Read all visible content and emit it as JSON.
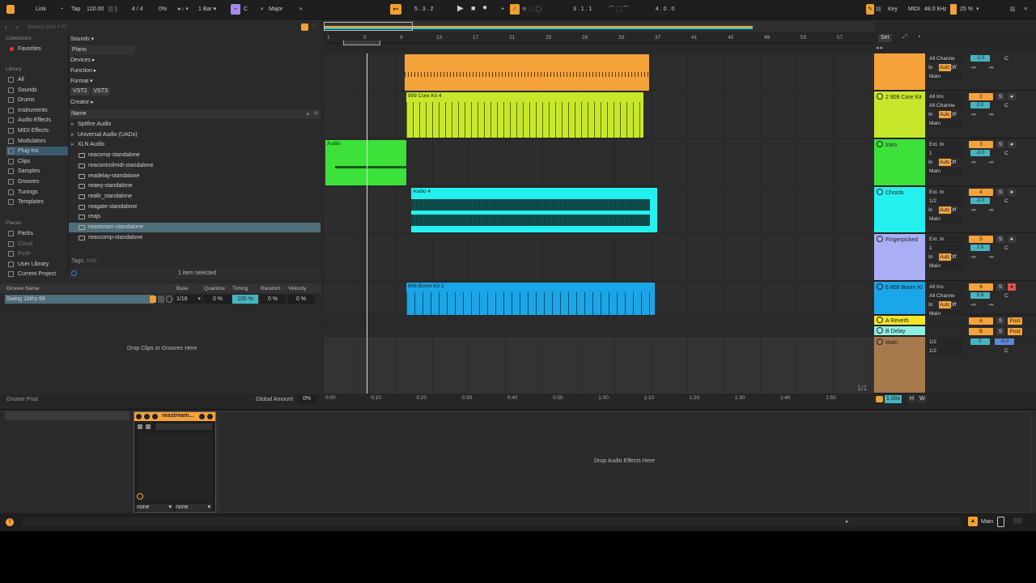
{
  "transport": {
    "link": "Link",
    "tap": "Tap",
    "tempo": "120.00",
    "meter": "4 / 4",
    "swing": "0%",
    "quantize": "1 Bar",
    "key": "C",
    "scale": "Major",
    "position": "5 .  3 .  2",
    "loop_start": "3 .  1 .  1",
    "loop_length": "4 .  0 .  0",
    "key_btn": "Key",
    "midi": "MIDI",
    "sample_rate": "48.0 kHz",
    "cpu": "25 %"
  },
  "browser": {
    "search_placeholder": "Search (Ctrl + F)",
    "collections_heading": "Collections",
    "favorites": "Favorites",
    "library_heading": "Library",
    "library": [
      "All",
      "Sounds",
      "Drums",
      "Instruments",
      "Audio Effects",
      "MIDI Effects",
      "Modulators",
      "Plug-Ins",
      "Clips",
      "Samples",
      "Grooves",
      "Tunings",
      "Templates"
    ],
    "places_heading": "Places",
    "places": [
      "Packs",
      "Cloud",
      "Push",
      "User Library",
      "Current Project"
    ],
    "filters": {
      "sounds": "Sounds ▾",
      "piano": "Piano",
      "devices": "Devices ▸",
      "function": "Function ▸",
      "format": "Format ▾",
      "vst2": "VST2",
      "vst3": "VST3",
      "creator": "Creator ▸"
    },
    "name_header": "Name",
    "folders": [
      "Spitfire Audio",
      "Universal Audio (UADx)",
      "XLN Audio"
    ],
    "files": [
      "reacomp-standalone",
      "reacontrolmidi-standalone",
      "readelay-standalone",
      "reaeq-standalone",
      "reafir_standalone",
      "reagate-standalone",
      "reajs",
      "reastream-standalone",
      "reaxcomp-standalone"
    ],
    "tags_label": "Tags:",
    "tags_placeholder": "Add...",
    "status": "1 item selected"
  },
  "groove": {
    "headers": [
      "Groove Name",
      "Base",
      "Quantize",
      "Timing",
      "Random",
      "Velocity"
    ],
    "row": {
      "name": "Swing 16ths 66",
      "base": "1/16",
      "quantize": "0 %",
      "timing": "100 %",
      "random": "0 %",
      "velocity": "0 %"
    },
    "drop_text": "Drop Clips or Grooves Here",
    "pool_label": "Groove Pool",
    "global_amount_label": "Global Amount",
    "global_amount": "0%"
  },
  "ruler": {
    "bars": [
      "1",
      "5",
      "9",
      "13",
      "17",
      "21",
      "25",
      "29",
      "33",
      "37",
      "41",
      "45",
      "49",
      "53",
      "57"
    ],
    "times": [
      "0:00",
      "0:10",
      "0:20",
      "0:30",
      "0:40",
      "0:50",
      "1:00",
      "1:10",
      "1:20",
      "1:30",
      "1:40",
      "1:50"
    ],
    "set_label": "Set",
    "page": "1/1",
    "zoom": "1.00x",
    "h": "H",
    "w": "W"
  },
  "tracks": [
    {
      "name": "",
      "color": "#f5a23a",
      "clip_name": "",
      "in_label": "All Channe",
      "mon": [
        "In",
        "Auto",
        "Off"
      ],
      "out": "Main",
      "vol": "-1.0",
      "pan": "C",
      "send": "-∞",
      "num": "",
      "solo": ""
    },
    {
      "name": "2 909 Core Kit",
      "color": "#c7e82a",
      "clip_name": "909 Core Kit 4",
      "in_label": "All Ins",
      "in2": "All Channe",
      "mon": [
        "In",
        "Auto",
        "Off"
      ],
      "out": "Main",
      "vol": "2.0",
      "pan": "C",
      "send": "-∞",
      "num": "2",
      "solo": "S"
    },
    {
      "name": "Intro",
      "color": "#3ce13a",
      "clip_name": "Audio",
      "in_label": "Ext. In",
      "in2": "1",
      "mon": [
        "In",
        "Auto",
        "Off"
      ],
      "out": "Main",
      "vol": "-3.0",
      "pan": "C",
      "send": "-∞",
      "num": "3",
      "solo": "S"
    },
    {
      "name": "Chords",
      "color": "#24f0f0",
      "clip_name": "Audio 4",
      "in_label": "Ext. In",
      "in2": "1/2",
      "mon": [
        "In",
        "Auto",
        "Off"
      ],
      "out": "Main",
      "vol": "-2.0",
      "pan": "C",
      "send": "-∞",
      "num": "4",
      "solo": "S"
    },
    {
      "name": "Fingerpicked",
      "color": "#a9aef5",
      "clip_name": "",
      "in_label": "Ext. In",
      "in2": "1",
      "mon": [
        "In",
        "Auto",
        "Off"
      ],
      "out": "Main",
      "vol": "2.0",
      "pan": "C",
      "send": "-∞",
      "num": "5",
      "solo": "S"
    },
    {
      "name": "6 808 Boom Ki",
      "color": "#1ba6e8",
      "clip_name": "808 Boom Kit 3",
      "in_label": "All Ins",
      "in2": "All Channe",
      "mon": [
        "In",
        "Auto",
        "Off"
      ],
      "out": "Main",
      "vol": "5.9",
      "pan": "C",
      "send": "-∞",
      "num": "6",
      "solo": "S"
    }
  ],
  "returns": [
    {
      "name": "A Reverb",
      "color": "#f2e62a",
      "letter": "A",
      "solo": "S",
      "post": "Post"
    },
    {
      "name": "B Delay",
      "color": "#8ef0e0",
      "letter": "B",
      "solo": "S",
      "post": "Post"
    }
  ],
  "main": {
    "name": "Main",
    "color": "#a77a4e",
    "out1": "1/2",
    "out2": "1/2",
    "vol": "0",
    "cue": "-6.0",
    "pan": "C"
  },
  "device": {
    "title": "reastream...",
    "sel1": "none",
    "sel2": "none",
    "drop_text": "Drop Audio Effects Here"
  },
  "status": {
    "main_label": "Main"
  },
  "colors": {
    "accent": "#f5a23a",
    "selection": "#4e6e7a"
  }
}
